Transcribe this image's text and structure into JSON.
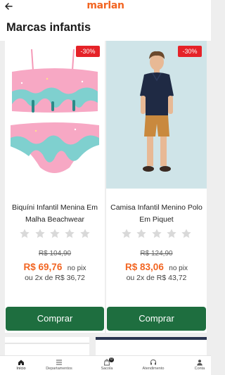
{
  "header": {
    "brand": "marlan",
    "brand_color": "#f26522"
  },
  "section": {
    "title": "Marcas infantis"
  },
  "products": [
    {
      "discount": "-30%",
      "name": "Biquíni Infantil Menina Em Malha Beachwear",
      "rating": 0,
      "old_price": "R$ 104,90",
      "price": "R$ 69,76",
      "pix_label": "no pix",
      "installments": "ou 2x de R$ 36,72",
      "buy_label": "Comprar"
    },
    {
      "discount": "-30%",
      "name": "Camisa Infantil Menino Polo Em Piquet",
      "rating": 0,
      "old_price": "R$ 124,90",
      "price": "R$ 83,06",
      "pix_label": "no pix",
      "installments": "ou 2x de R$ 43,72",
      "buy_label": "Comprar"
    }
  ],
  "bottom_nav": {
    "items": [
      {
        "label": "Início",
        "icon": "home-icon"
      },
      {
        "label": "Departamentos",
        "icon": "list-icon"
      },
      {
        "label": "Sacola",
        "icon": "bag-icon",
        "badge": "0"
      },
      {
        "label": "Atendimento",
        "icon": "headset-icon"
      },
      {
        "label": "Conta",
        "icon": "user-icon"
      }
    ]
  },
  "colors": {
    "accent": "#f26522",
    "buy_button": "#1e6e3f",
    "discount_badge": "#e52228"
  }
}
